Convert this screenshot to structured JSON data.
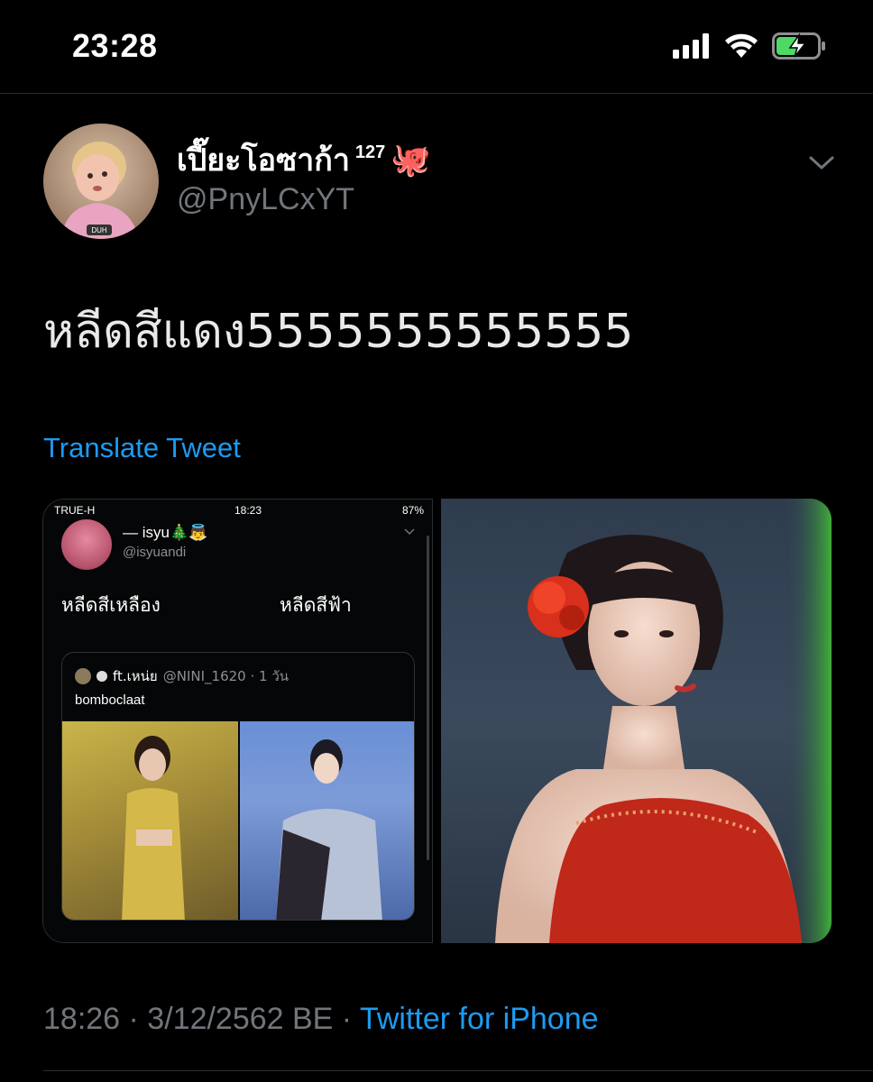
{
  "status_bar": {
    "time": "23:28",
    "signal_icon": "cellular-signal-icon",
    "wifi_icon": "wifi-icon",
    "battery_icon": "battery-charging-icon",
    "battery_color": "#4cd964"
  },
  "tweet": {
    "display_name": "เปี๊ยะโอซาก้า",
    "name_superscript": "127",
    "name_emoji": "🐙",
    "handle": "@PnyLCxYT",
    "avatar_caption": "DUH",
    "text": "หลีดสีแดง5555555555555",
    "translate_label": "Translate Tweet",
    "timestamp": "18:26 · 3/12/2562 BE · ",
    "source": "Twitter for iPhone"
  },
  "media_left": {
    "status_carrier": "TRUE-H",
    "status_time": "18:23",
    "status_battery": "87%",
    "name": "— isyu🎄👼",
    "handle": "@isyuandi",
    "text_a": "หลีดสีเหลือง",
    "text_b": "หลีดสีฟ้า",
    "quote": {
      "author": "ft.เหน่ย",
      "handle": "@NINI_1620 · 1 วัน",
      "text": "bomboclaat"
    }
  },
  "media_right": {
    "photo_icon": "concert-photo-icon"
  },
  "colors": {
    "background": "#000000",
    "link": "#1d9bf0",
    "secondary_text": "#71767b"
  }
}
